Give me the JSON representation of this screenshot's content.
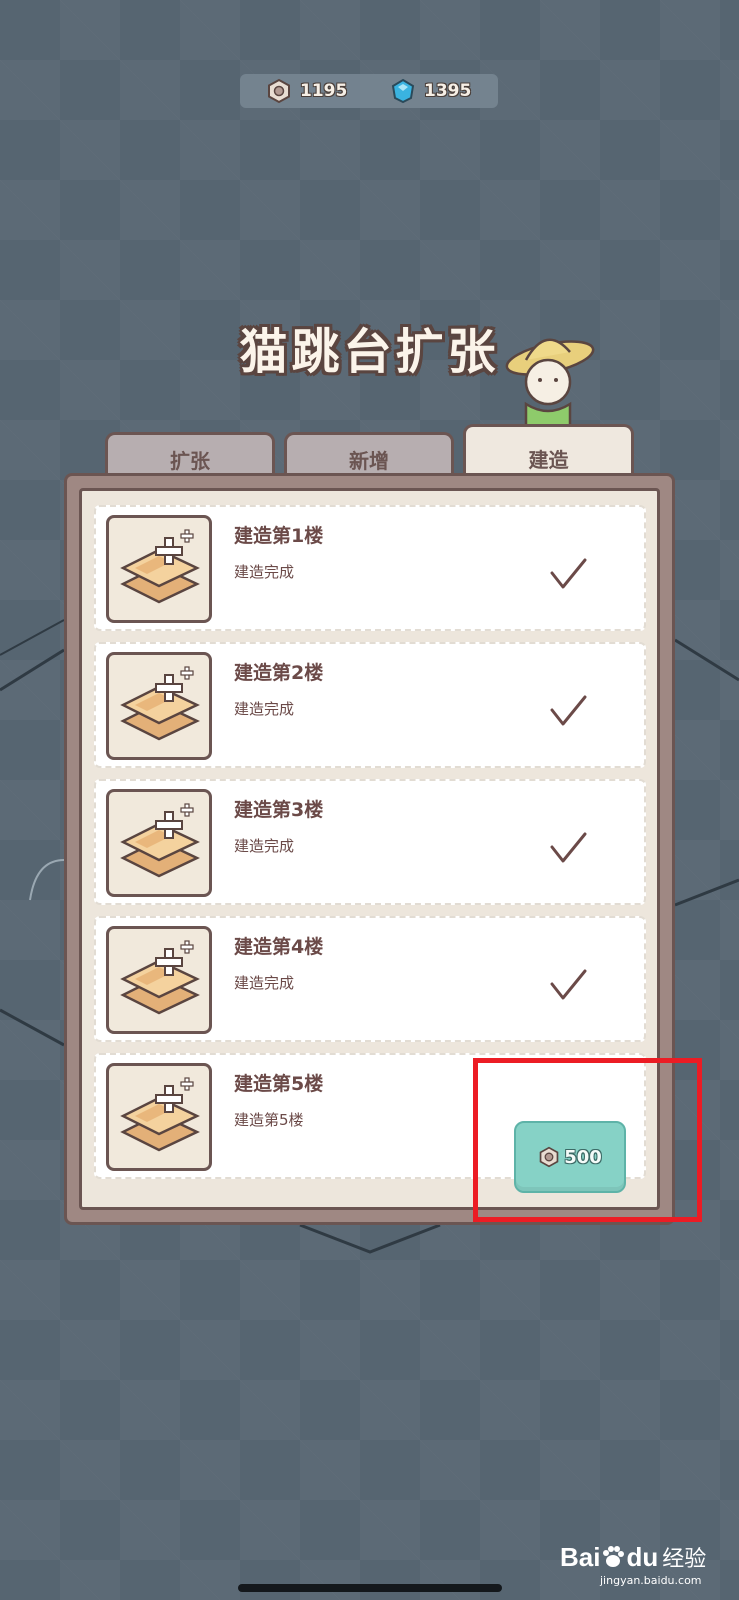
{
  "currency": {
    "coins": "1195",
    "gems": "1395",
    "coin_icon": "hex-nut-coin-icon",
    "gem_icon": "blue-gem-icon"
  },
  "title": "猫跳台扩张",
  "tabs": [
    {
      "label": "扩张",
      "active": false
    },
    {
      "label": "新增",
      "active": false
    },
    {
      "label": "建造",
      "active": true
    }
  ],
  "rows": [
    {
      "title": "建造第1楼",
      "desc": "建造完成",
      "status": "done"
    },
    {
      "title": "建造第2楼",
      "desc": "建造完成",
      "status": "done"
    },
    {
      "title": "建造第3楼",
      "desc": "建造完成",
      "status": "done"
    },
    {
      "title": "建造第4楼",
      "desc": "建造完成",
      "status": "done"
    },
    {
      "title": "建造第5楼",
      "desc": "建造第5楼",
      "status": "buy",
      "cost": "500"
    }
  ],
  "watermark": {
    "logo": "Bai",
    "logo2": "du",
    "cn": "经验",
    "url": "jingyan.baidu.com"
  },
  "colors": {
    "accent": "#86d2c6",
    "highlight": "#ec1c24",
    "panel": "#9f8883",
    "text": "#6b4a48"
  }
}
